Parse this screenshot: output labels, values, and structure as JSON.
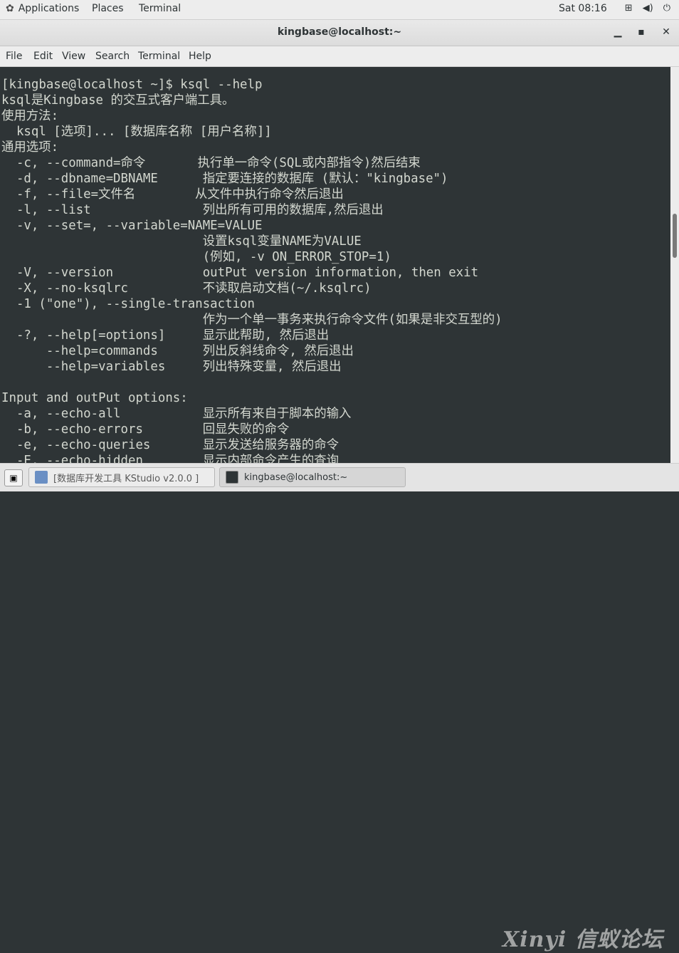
{
  "top_bar": {
    "applications": "Applications",
    "places": "Places",
    "terminal": "Terminal",
    "clock": "Sat 08:16",
    "icons": [
      "network-icon",
      "volume-icon",
      "power-icon"
    ]
  },
  "window": {
    "title": "kingbase@localhost:~"
  },
  "menu": {
    "file": "File",
    "edit": "Edit",
    "view": "View",
    "search": "Search",
    "terminal": "Terminal",
    "help": "Help"
  },
  "terminal": {
    "lines": [
      "[kingbase@localhost ~]$ ksql --help",
      "ksql是Kingbase 的交互式客户端工具。",
      "使用方法:",
      "  ksql [选项]... [数据库名称 [用户名称]]",
      "通用选项:",
      "  -c, --command=命令       执行单一命令(SQL或内部指令)然后结束",
      "  -d, --dbname=DBNAME      指定要连接的数据库 (默认：\"kingbase\")",
      "  -f, --file=文件名        从文件中执行命令然后退出",
      "  -l, --list               列出所有可用的数据库,然后退出",
      "  -v, --set=, --variable=NAME=VALUE",
      "                           设置ksql变量NAME为VALUE",
      "                           (例如, -v ON_ERROR_STOP=1)",
      "  -V, --version            outPut version information, then exit",
      "  -X, --no-ksqlrc          不读取启动文档(~/.ksqlrc)",
      "  -1 (\"one\"), --single-transaction",
      "                           作为一个单一事务来执行命令文件(如果是非交互型的)",
      "  -?, --help[=options]     显示此帮助, 然后退出",
      "      --help=commands      列出反斜线命令, 然后退出",
      "      --help=variables     列出特殊变量, 然后退出",
      "",
      "Input and outPut options:",
      "  -a, --echo-all           显示所有来自于脚本的输入",
      "  -b, --echo-errors        回显失败的命令",
      "  -e, --echo-queries       显示发送给服务器的命令",
      "  -E, --echo-hidden        显示内部命令产生的查询"
    ]
  },
  "taskbar": {
    "task1": "[数据库开发工具 KStudio v2.0.0 ]",
    "task2": "kingbase@localhost:~",
    "watermark": "Xinyi 信蚁论坛"
  }
}
